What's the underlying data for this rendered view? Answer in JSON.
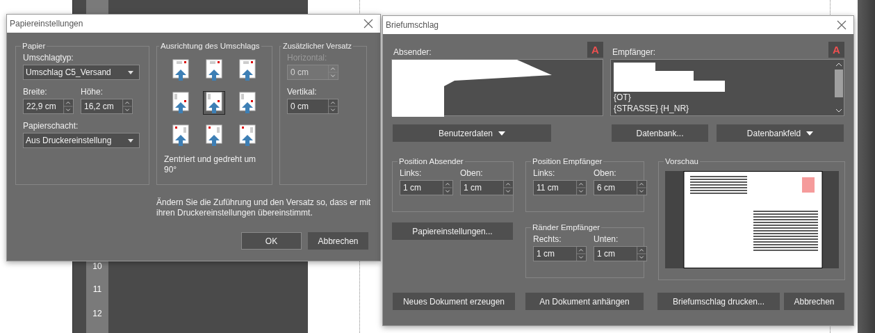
{
  "ruler": {
    "numbers": [
      "10",
      "11",
      "12"
    ]
  },
  "paper_dialog": {
    "title": "Papiereinstellungen",
    "paper_group": {
      "title": "Papier",
      "envelope_type": {
        "label": "Umschlagtyp:",
        "value": "Umschlag C5_Versand"
      },
      "width": {
        "label": "Breite:",
        "value": "22,9 cm"
      },
      "height": {
        "label": "Höhe:",
        "value": "16,2 cm"
      },
      "tray": {
        "label": "Papierschacht:",
        "value": "Aus Druckereinstellung"
      }
    },
    "orientation_group": {
      "title": "Ausrichtung des Umschlags",
      "options": [
        {
          "kind": "horizontal",
          "selected": false
        },
        {
          "kind": "horizontal",
          "selected": false
        },
        {
          "kind": "horizontal",
          "selected": false
        },
        {
          "kind": "rotated-right",
          "selected": false
        },
        {
          "kind": "rotated-right",
          "selected": true
        },
        {
          "kind": "rotated-right",
          "selected": false
        },
        {
          "kind": "rotated-left",
          "selected": false
        },
        {
          "kind": "rotated-left",
          "selected": false
        },
        {
          "kind": "rotated-left",
          "selected": false
        }
      ],
      "caption": "Zentriert und gedreht um 90°"
    },
    "offset_group": {
      "title": "Zusätzlicher Versatz",
      "horizontal": {
        "label": "Horizontal:",
        "value": "0 cm",
        "disabled": true
      },
      "vertical": {
        "label": "Vertikal:",
        "value": "0 cm",
        "disabled": false
      }
    },
    "hint": "Ändern Sie die Zuführung und den Versatz so, dass er mit ihren Druckereinstellungen übereinstimmt.",
    "buttons": [
      {
        "label": "OK",
        "default": true
      },
      {
        "label": "Abbrechen",
        "default": false
      }
    ]
  },
  "envelope_dialog": {
    "title": "Briefumschlag",
    "sender": {
      "label": "Absender:",
      "font_button": "A"
    },
    "recipient": {
      "label": "Empfänger:",
      "font_button": "A",
      "lines": [
        "{OT}",
        "{STRASSE} {H_NR}"
      ]
    },
    "sender_buttons": [
      {
        "label": "Benutzerdaten",
        "kind": "menu"
      }
    ],
    "recipient_buttons": [
      {
        "label": "Datenbank...",
        "kind": "plain"
      },
      {
        "label": "Datenbankfeld",
        "kind": "menu"
      }
    ],
    "position_sender": {
      "title": "Position Absender",
      "fields": [
        {
          "label": "Links:",
          "value": "1 cm"
        },
        {
          "label": "Oben:",
          "value": "1 cm"
        }
      ]
    },
    "position_recipient": {
      "title": "Position Empfänger",
      "fields": [
        {
          "label": "Links:",
          "value": "11 cm"
        },
        {
          "label": "Oben:",
          "value": "6 cm"
        }
      ]
    },
    "paper_settings_button": "Papiereinstellungen...",
    "margins_recipient": {
      "title": "Ränder Empfänger",
      "fields": [
        {
          "label": "Rechts:",
          "value": "1 cm"
        },
        {
          "label": "Unten:",
          "value": "1 cm"
        }
      ]
    },
    "preview": {
      "title": "Vorschau"
    },
    "footer_buttons": [
      "Neues Dokument erzeugen",
      "An Dokument anhängen",
      "Briefumschlag drucken...",
      "Abbrechen"
    ]
  }
}
